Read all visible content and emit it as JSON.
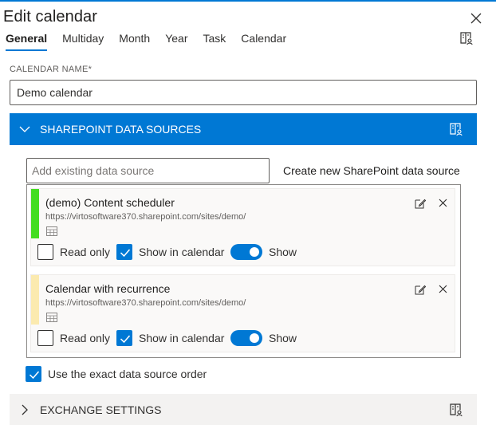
{
  "dialog": {
    "title": "Edit calendar"
  },
  "tabs": [
    {
      "label": "General",
      "active": true
    },
    {
      "label": "Multiday",
      "active": false
    },
    {
      "label": "Month",
      "active": false
    },
    {
      "label": "Year",
      "active": false
    },
    {
      "label": "Task",
      "active": false
    },
    {
      "label": "Calendar",
      "active": false
    }
  ],
  "calendar_name": {
    "label": "CALENDAR NAME*",
    "value": "Demo calendar"
  },
  "sharepoint_section": {
    "title": "SHAREPOINT DATA SOURCES",
    "expanded": true,
    "add_placeholder": "Add existing data source",
    "create_link": "Create new SharePoint data source",
    "sources": [
      {
        "title": "(demo) Content scheduler",
        "url": "https://virtosoftware370.sharepoint.com/sites/demo/",
        "color": "#44dd22",
        "read_only_label": "Read only",
        "read_only": false,
        "show_in_calendar_label": "Show in calendar",
        "show_in_calendar": true,
        "toggle_label": "Show",
        "toggle_on": true
      },
      {
        "title": "Calendar with recurrence",
        "url": "https://virtosoftware370.sharepoint.com/sites/demo/",
        "color": "#fbeaaf",
        "read_only_label": "Read only",
        "read_only": false,
        "show_in_calendar_label": "Show in calendar",
        "show_in_calendar": true,
        "toggle_label": "Show",
        "toggle_on": true
      }
    ]
  },
  "exact_order": {
    "label": "Use the exact data source order",
    "checked": true
  },
  "exchange_section": {
    "title": "EXCHANGE SETTINGS",
    "expanded": false
  },
  "colors": {
    "accent": "#0078d4",
    "section_grey": "#f3f2f1"
  },
  "icons": [
    "close-icon",
    "book-icon",
    "chevron-down-icon",
    "chevron-right-icon",
    "grid-icon",
    "edit-icon",
    "checkmark-icon"
  ]
}
